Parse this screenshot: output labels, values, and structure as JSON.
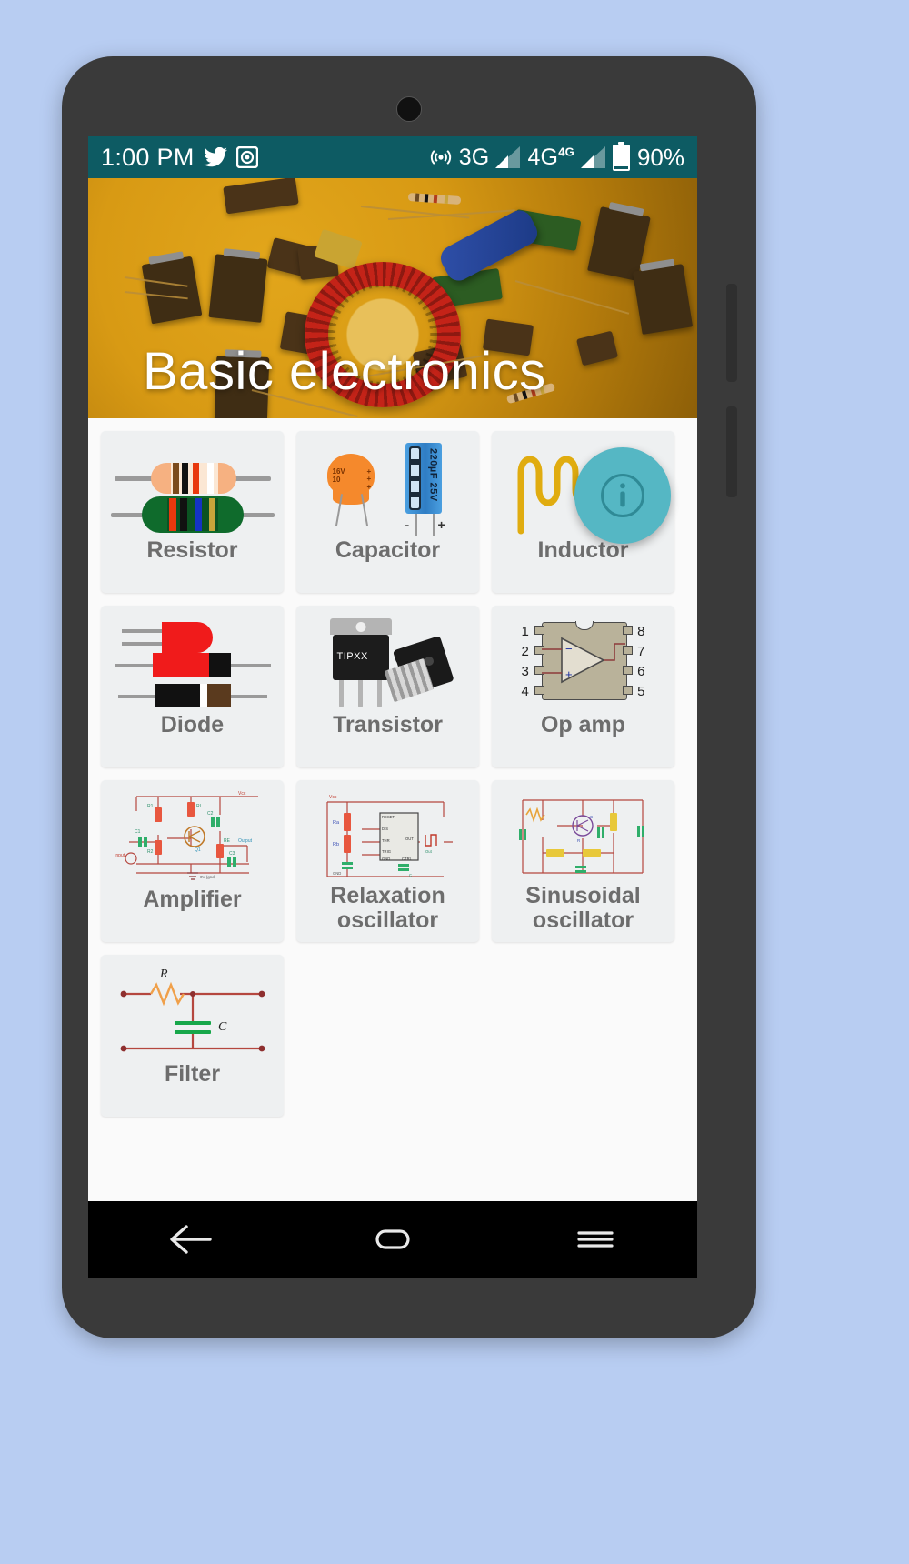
{
  "status_bar": {
    "time": "1:00 PM",
    "icons_left": [
      "twitter-icon",
      "camera-record-icon"
    ],
    "icons_right": [
      "wifi-hotspot-icon",
      "signal-bars-icon",
      "signal-bars-icon",
      "battery-icon"
    ],
    "network_1": "3G",
    "network_2": "4G",
    "network_2_sup": "4G",
    "battery_percent": "90%",
    "bg_color": "#0d5b63"
  },
  "hero": {
    "title": "Basic electronics",
    "image_alt": "assorted electronic components on orange background with red toroid inductor"
  },
  "fab": {
    "icon": "info-icon",
    "label": "i",
    "color": "#55b7c4"
  },
  "grid": {
    "cards": [
      {
        "label": "Resistor",
        "art": "resistor-art",
        "lines": 1
      },
      {
        "label": "Capacitor",
        "art": "capacitor-art",
        "lines": 1
      },
      {
        "label": "Inductor",
        "art": "inductor-art",
        "lines": 1
      },
      {
        "label": "Diode",
        "art": "diode-art",
        "lines": 1
      },
      {
        "label": "Transistor",
        "art": "transistor-art",
        "lines": 1
      },
      {
        "label": "Op amp",
        "art": "opamp-art",
        "lines": 1
      },
      {
        "label": "Amplifier",
        "art": "amplifier-schematic-art",
        "lines": 1
      },
      {
        "label": "Relaxation oscillator",
        "art": "relaxation-oscillator-art",
        "lines": 2
      },
      {
        "label": "Sinusoidal oscillator",
        "art": "sinusoidal-oscillator-art",
        "lines": 2
      },
      {
        "label": "Filter",
        "art": "rc-filter-art",
        "lines": 1
      }
    ]
  },
  "art_labels": {
    "ceramic_cap_voltage": "16V",
    "ceramic_cap_value": "10",
    "ceramic_cap_plus": "+++",
    "electrolytic_cap": "220µF 25V",
    "cap_minus": "-",
    "cap_plus": "+",
    "transistor_part": "TIPXX",
    "opamp_pins_left": [
      "1",
      "2",
      "3",
      "4"
    ],
    "opamp_pins_right": [
      "8",
      "7",
      "6",
      "5"
    ],
    "opamp_inverting": "−",
    "opamp_noninverting": "+",
    "filter_resistor": "R",
    "filter_capacitor": "C",
    "amplifier_supply": "Vcc",
    "amplifier_ground": "0V (gnd)",
    "amplifier_input": "Input",
    "amplifier_output": "Output",
    "amplifier_parts": [
      "R1",
      "RL",
      "C1",
      "C2",
      "R2",
      "RE",
      "C3",
      "Q1"
    ],
    "relaxation_parts": [
      "Ra",
      "Rb",
      "RESET",
      "DIS",
      "THR",
      "TRIG",
      "GND",
      "CTRL",
      "OUT",
      "Vcc",
      "C"
    ]
  },
  "navbar": {
    "buttons": [
      {
        "name": "back-button",
        "icon": "arrow-left-icon"
      },
      {
        "name": "home-button",
        "icon": "home-oval-icon"
      },
      {
        "name": "recents-button",
        "icon": "menu-lines-icon"
      }
    ]
  },
  "colors": {
    "accent": "#55b7c4",
    "status_bar": "#0d5b63",
    "card_bg": "#eef0f1",
    "card_label": "#6d6d6d",
    "page_bg": "#fafafa",
    "wallpaper": "#b8cdf2"
  }
}
